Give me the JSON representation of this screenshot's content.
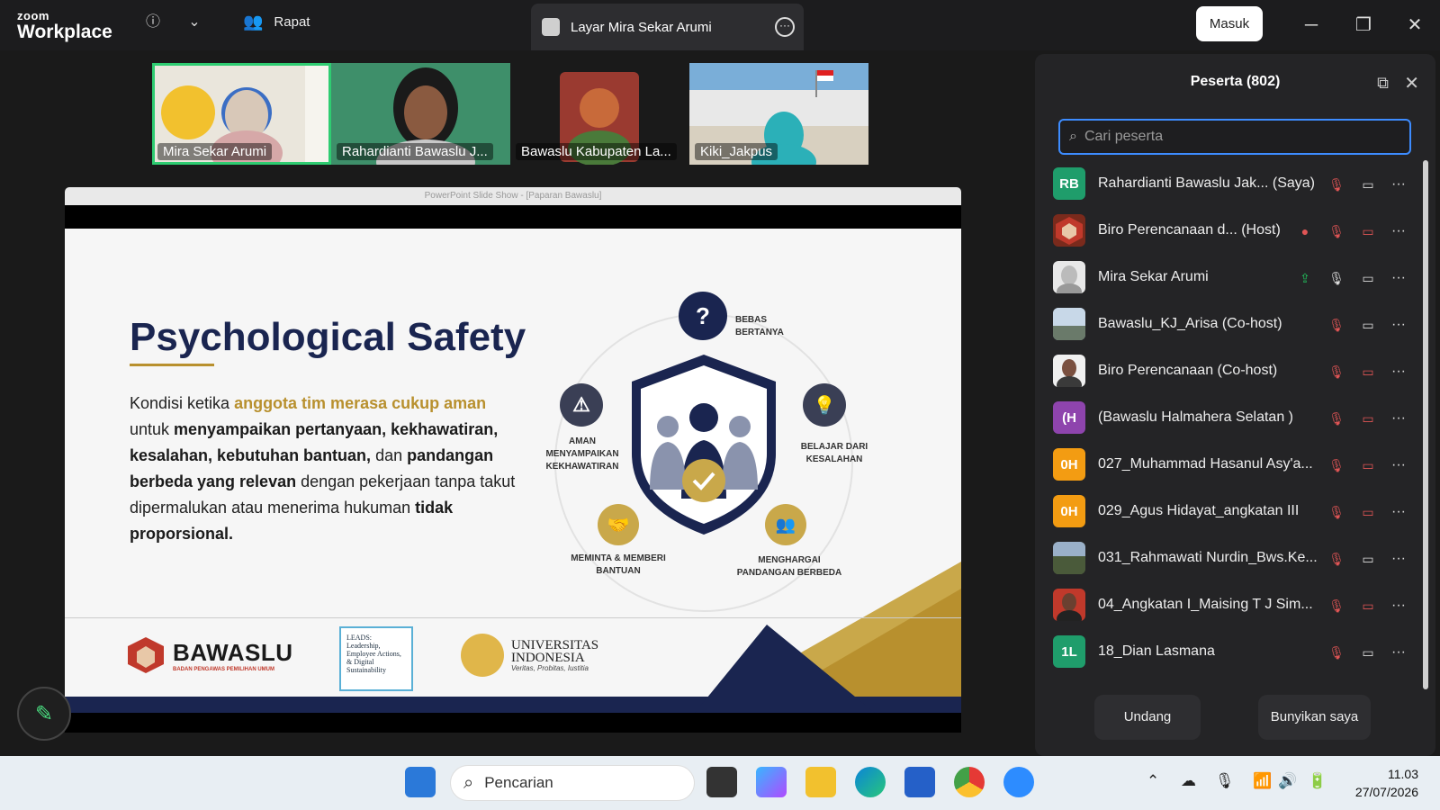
{
  "titlebar": {
    "brand_top": "zoom",
    "brand_bottom": "Workplace",
    "meeting_label": "Rapat",
    "share_tab_label": "Layar Mira Sekar Arumi",
    "signin_label": "Masuk"
  },
  "thumbnails": [
    {
      "name": "Mira Sekar Arumi",
      "active": true
    },
    {
      "name": "Rahardianti Bawaslu J...",
      "active": false
    },
    {
      "name": "Bawaslu Kabupaten La...",
      "active": false
    },
    {
      "name": "Kiki_Jakpus",
      "active": false
    }
  ],
  "slide": {
    "window_title": "PowerPoint Slide Show - [Paparan Bawaslu]",
    "title": "Psychological Safety",
    "body_1": "Kondisi ketika ",
    "body_2": "anggota tim merasa cukup aman",
    "body_3": " untuk ",
    "body_4": "menyampaikan pertanyaan, kekhawatiran, kesalahan, kebutuhan bantuan,",
    "body_5": " dan ",
    "body_6": "pandangan berbeda yang relevan",
    "body_7": " dengan pekerjaan tanpa takut dipermalukan atau menerima hukuman ",
    "body_8": "tidak proporsional.",
    "label_top": "BEBAS BERTANYA",
    "label_left": "AMAN MENYAMPAIKAN KEKHAWATIRAN",
    "label_right": "BELAJAR DARI KESALAHAN",
    "label_bl": "MEMINTA & MEMBERI BANTUAN",
    "label_br": "MENGHARGAI PANDANGAN BERBEDA",
    "logo_bawaslu": "BAWASLU",
    "logo_bawaslu_sub": "BADAN PENGAWAS PEMILIHAN UMUM",
    "logo_leads": "LEADS: Leadership, Employee Actions, & Digital Sustainability",
    "logo_ui_1": "UNIVERSITAS",
    "logo_ui_2": "INDONESIA",
    "logo_ui_motto": "Veritas, Probitas, Iustitia"
  },
  "panel": {
    "title": "Peserta (802)",
    "search_placeholder": "Cari peserta",
    "invite_label": "Undang",
    "unmute_label": "Bunyikan saya",
    "participants": [
      {
        "initials": "RB",
        "name": "Rahardianti Bawaslu Jak...  (Saya)",
        "color": "#1f9d6b"
      },
      {
        "initials": "",
        "name": "Biro Perencanaan d...  (Host)",
        "color": "#7a2a1c"
      },
      {
        "initials": "",
        "name": "Mira Sekar Arumi",
        "color": "#c9c9c9"
      },
      {
        "initials": "",
        "name": "Bawaslu_KJ_Arisa (Co-host)",
        "color": "#8ea2b0"
      },
      {
        "initials": "",
        "name": "Biro Perencanaan (Co-host)",
        "color": "#9a8070"
      },
      {
        "initials": "(H",
        "name": "(Bawaslu  Halmahera Selatan )",
        "color": "#8e44ad"
      },
      {
        "initials": "0H",
        "name": "027_Muhammad Hasanul Asy'a...",
        "color": "#f39c12"
      },
      {
        "initials": "0H",
        "name": "029_Agus Hidayat_angkatan III",
        "color": "#f39c12"
      },
      {
        "initials": "",
        "name": "031_Rahmawati Nurdin_Bws.Ke...",
        "color": "#5a6b4a"
      },
      {
        "initials": "",
        "name": "04_Angkatan I_Maising T J Sim...",
        "color": "#c0392b"
      },
      {
        "initials": "1L",
        "name": "18_Dian Lasmana",
        "color": "#1f9d6b"
      }
    ]
  },
  "taskbar": {
    "search_label": "Pencarian",
    "time": "11.03",
    "date": "27/07/2026"
  }
}
